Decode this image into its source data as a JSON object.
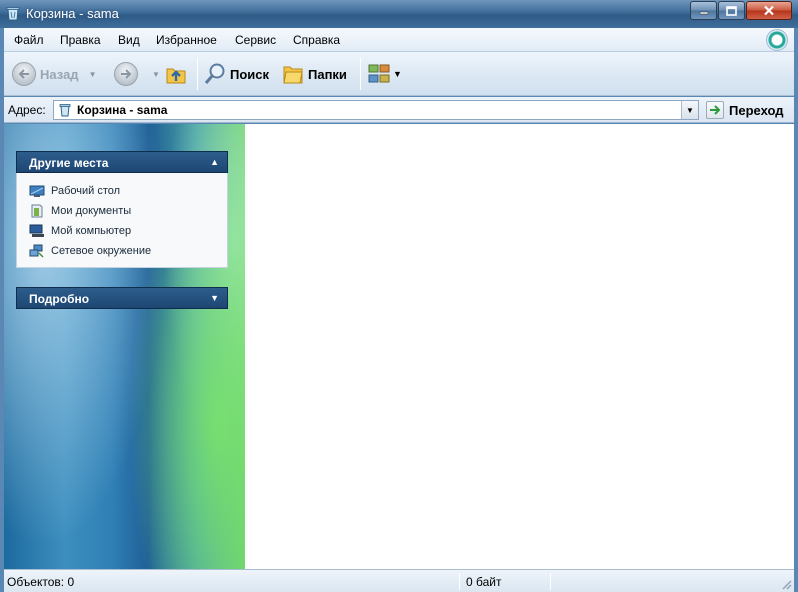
{
  "window": {
    "title": "Корзина - sama",
    "controls": {
      "minimize": "minimize-icon",
      "maximize": "maximize-icon",
      "close": "close-icon"
    }
  },
  "menu": {
    "items": [
      {
        "label": "Файл"
      },
      {
        "label": "Правка"
      },
      {
        "label": "Вид"
      },
      {
        "label": "Избранное"
      },
      {
        "label": "Сервис"
      },
      {
        "label": "Справка"
      }
    ]
  },
  "toolbar": {
    "back_label": "Назад",
    "search_label": "Поиск",
    "folders_label": "Папки"
  },
  "address": {
    "label": "Адрес:",
    "value": "Корзина - sama",
    "go_label": "Переход"
  },
  "taskpane": {
    "other_places": {
      "title": "Другие места",
      "items": [
        {
          "label": "Рабочий стол",
          "icon": "desktop-icon"
        },
        {
          "label": "Мои документы",
          "icon": "documents-icon"
        },
        {
          "label": "Мой компьютер",
          "icon": "computer-icon"
        },
        {
          "label": "Сетевое окружение",
          "icon": "network-icon"
        }
      ]
    },
    "details": {
      "title": "Подробно"
    }
  },
  "statusbar": {
    "objects": "Объектов: 0",
    "size": "0 байт"
  },
  "colors": {
    "titlebar": "#3d6b98",
    "panel_header": "#1e4673",
    "content_bg": "#ffffff"
  }
}
